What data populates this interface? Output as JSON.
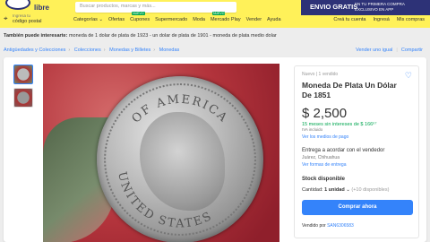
{
  "header": {
    "logo_text": "libre",
    "search_placeholder": "Buscar productos, marcas y más...",
    "promo_title": "ENVIO GRATIS",
    "promo_sub": "EN TU PRIMERA COMPRA EXCLUSIVO EN APP",
    "location_line1": "Ingresa tu",
    "location_line2": "código postal",
    "nav": [
      "Categorías ⌄",
      "Ofertas",
      "Cupones",
      "Supermercado",
      "Moda",
      "Mercado Play",
      "Vender",
      "Ayuda"
    ],
    "new_badge": "NUEVO",
    "user_nav": [
      "Creá tu cuenta",
      "Ingresá",
      "Mis compras"
    ]
  },
  "also_searched": {
    "label": "También puede interesarte:",
    "text": "moneda de 1 dolar de plata de 1923 - un dolar de plata de 1901 - moneda de plata medio dolar"
  },
  "breadcrumb": [
    "Antigüedades y Colecciones",
    "Colecciones",
    "Monedas y Billetes",
    "Monedas"
  ],
  "right_links": [
    "Vender uno igual",
    "Compartir"
  ],
  "product": {
    "condition": "Nuevo  |  1 vendido",
    "title": "Moneda De Plata Un Dólar De 1851",
    "price": "$ 2,500",
    "installments": "15 meses sin intereses de $ 166⁶⁷",
    "iva": "IVA incluido",
    "payment_link": "Ver los medios de pago",
    "delivery_line1": "Entrega a acordar con el vendedor",
    "delivery_line2": "Juárez, Chihuahua",
    "delivery_link": "Ver formas de entrega",
    "stock": "Stock disponible",
    "qty_label": "Cantidad:",
    "qty_value": "1 unidad",
    "qty_available": "(+10 disponibles)",
    "buy_button": "Comprar ahora",
    "seller_label": "Vendido por",
    "seller_name": "SAN6306583"
  },
  "coin_text": {
    "top": "OF AMERICA",
    "bottom": "UNITED STATES"
  },
  "colors": {
    "header_bg": "#fff159",
    "accent_blue": "#3483fa",
    "green": "#00a650",
    "promo_bg": "#2d3277"
  },
  "icons": [
    "location-pin-icon",
    "heart-icon"
  ]
}
